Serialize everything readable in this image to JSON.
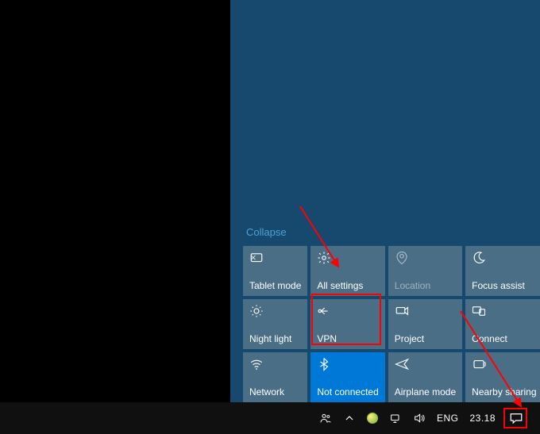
{
  "action_center": {
    "collapse_label": "Collapse",
    "tiles": [
      {
        "id": "tablet-mode",
        "label": "Tablet mode",
        "icon": "tablet-mode-icon",
        "state": "normal"
      },
      {
        "id": "all-settings",
        "label": "All settings",
        "icon": "gear-icon",
        "state": "normal"
      },
      {
        "id": "location",
        "label": "Location",
        "icon": "location-icon",
        "state": "dim"
      },
      {
        "id": "focus-assist",
        "label": "Focus assist",
        "icon": "moon-icon",
        "state": "normal"
      },
      {
        "id": "night-light",
        "label": "Night light",
        "icon": "sun-icon",
        "state": "normal"
      },
      {
        "id": "vpn",
        "label": "VPN",
        "icon": "vpn-icon",
        "state": "normal"
      },
      {
        "id": "project",
        "label": "Project",
        "icon": "project-icon",
        "state": "normal"
      },
      {
        "id": "connect",
        "label": "Connect",
        "icon": "connect-icon",
        "state": "normal"
      },
      {
        "id": "network",
        "label": "Network",
        "icon": "wifi-icon",
        "state": "normal"
      },
      {
        "id": "bluetooth",
        "label": "Not connected",
        "icon": "bluetooth-icon",
        "state": "active"
      },
      {
        "id": "airplane-mode",
        "label": "Airplane mode",
        "icon": "airplane-icon",
        "state": "normal"
      },
      {
        "id": "nearby-sharing",
        "label": "Nearby sharing",
        "icon": "nearby-sharing-icon",
        "state": "normal"
      }
    ]
  },
  "taskbar": {
    "language": "ENG",
    "clock": "23.18"
  },
  "annotation": {
    "color": "#ff0000"
  }
}
